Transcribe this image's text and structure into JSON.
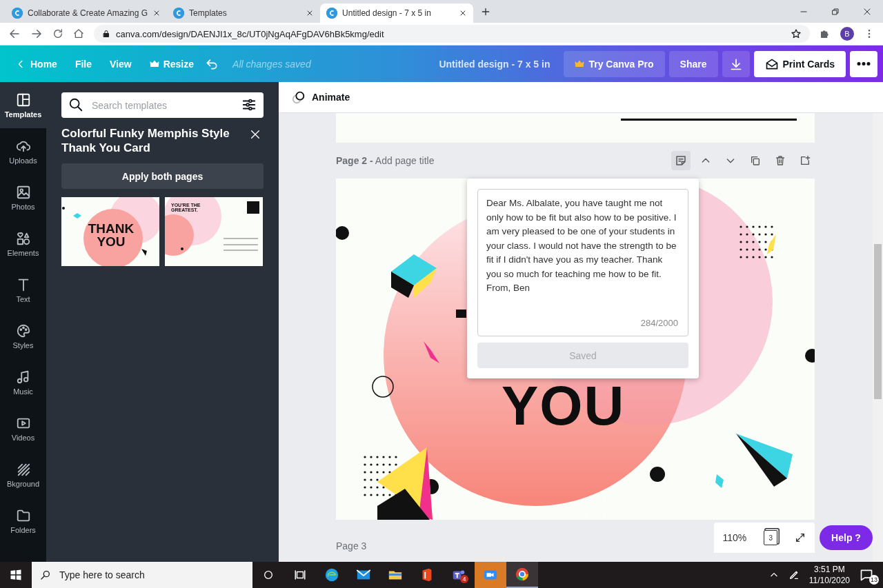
{
  "browser": {
    "tabs": [
      {
        "title": "Collaborate & Create Amazing G",
        "selected": false
      },
      {
        "title": "Templates",
        "selected": false
      },
      {
        "title": "Untitled design - 7 x 5 in",
        "selected": true
      }
    ],
    "url": "canva.com/design/DAENJI1x_8c/UT0jNgAqAFgDAV6hBk5kmg/edit",
    "profile": "B"
  },
  "header": {
    "nav": [
      {
        "label": "Home",
        "kind": "back"
      },
      {
        "label": "File",
        "kind": "plain"
      },
      {
        "label": "View",
        "kind": "plain"
      },
      {
        "label": "Resize",
        "kind": "crown"
      }
    ],
    "status": "All changes saved",
    "title": "Untitled design - 7 x 5 in",
    "buttons": [
      {
        "label": "Try Canva Pro",
        "kind": "pro"
      },
      {
        "label": "Share",
        "kind": "share"
      },
      {
        "label": "Print Cards",
        "kind": "print"
      }
    ]
  },
  "sidebar": {
    "items": [
      {
        "label": "Templates",
        "selected": true
      },
      {
        "label": "Uploads",
        "selected": false
      },
      {
        "label": "Photos",
        "selected": false
      },
      {
        "label": "Elements",
        "selected": false
      },
      {
        "label": "Text",
        "selected": false
      },
      {
        "label": "Styles",
        "selected": false
      },
      {
        "label": "Music",
        "selected": false
      },
      {
        "label": "Videos",
        "selected": false
      },
      {
        "label": "Bkground",
        "selected": false
      },
      {
        "label": "Folders",
        "selected": false
      }
    ]
  },
  "panel": {
    "search": {
      "placeholder": "Search templates"
    },
    "title": "Colorful Funky Memphis Style Thank You Card",
    "apply": "Apply both pages",
    "thumbnails": [
      {
        "kind": "front",
        "text": "THANK YOU"
      },
      {
        "kind": "back",
        "text": "YOU'RE THE GREATEST."
      }
    ]
  },
  "editor": {
    "animate": "Animate",
    "page2": {
      "label": "Page 2 -",
      "title_placeholder": "Add page title",
      "card_text": "YOU"
    },
    "note": {
      "text": "Dear Ms. Albalate, you have taught me not only how to be fit but also how to be positive. I am very pleased to be one of your students in your class. I would not have the strength to be fit if I didn't have you as my teacher. Thank you so much for teaching me how to be fit. From, Ben",
      "counter": "284/2000",
      "button": {
        "label": "Saved",
        "disabled": true
      }
    },
    "page3": "Page 3",
    "zoom": "110%",
    "page_count": "3",
    "help": "Help ?"
  },
  "taskbar": {
    "search_placeholder": "Type here to search",
    "apps": [
      {
        "kind": "edge",
        "selected": false,
        "flashing": false
      },
      {
        "kind": "mail",
        "selected": false,
        "flashing": false
      },
      {
        "kind": "explorer",
        "selected": false,
        "flashing": false
      },
      {
        "kind": "office",
        "selected": false,
        "flashing": false
      },
      {
        "kind": "teams",
        "selected": false,
        "flashing": false,
        "badge": "4"
      },
      {
        "kind": "zoom",
        "selected": false,
        "flashing": true
      },
      {
        "kind": "chrome",
        "selected": true,
        "flashing": false
      }
    ],
    "time": "3:51 PM",
    "date": "11/10/2020",
    "notifications": "13"
  }
}
